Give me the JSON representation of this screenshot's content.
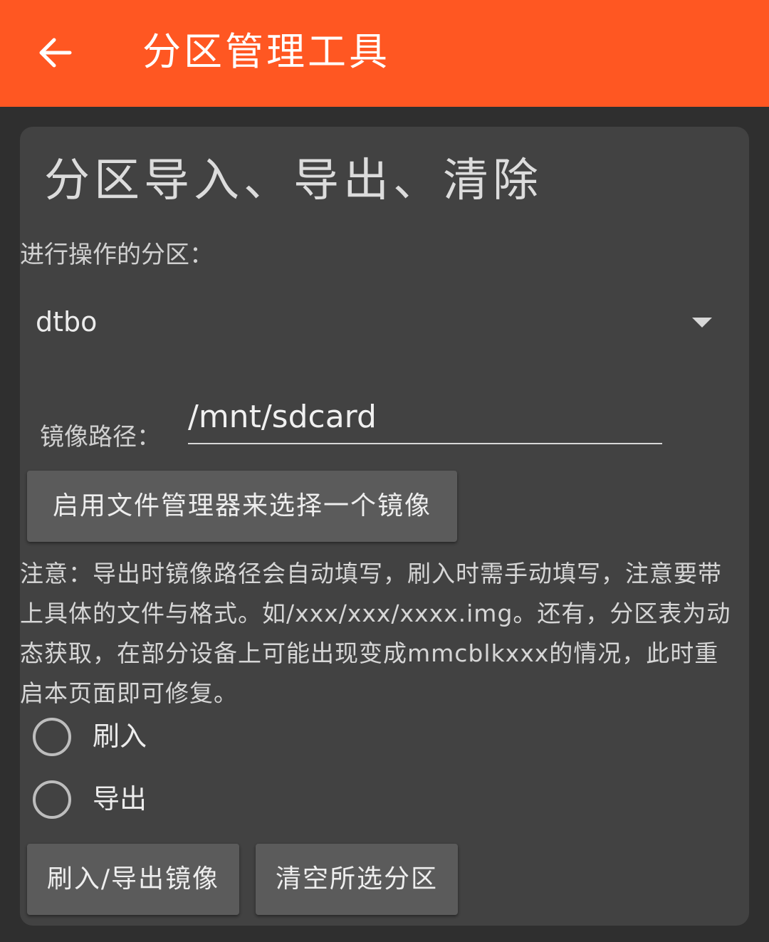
{
  "app_bar": {
    "title": "分区管理工具",
    "back_icon": "arrow-left-icon",
    "background": "#ff5722"
  },
  "card": {
    "title": "分区导入、导出、清除",
    "partition_label": "进行操作的分区：",
    "partition_selected": "dtbo",
    "image_path_label": "镜像路径：",
    "image_path_value": "/mnt/sdcard",
    "file_manager_button": "启用文件管理器来选择一个镜像",
    "note": "注意：导出时镜像路径会自动填写，刷入时需手动填写，注意要带上具体的文件与格式。如/xxx/xxx/xxxx.img。还有，分区表为动态获取，在部分设备上可能出现变成mmcblkxxx的情况，此时重启本页面即可修复。",
    "radio_options": [
      {
        "label": "刷入",
        "checked": false
      },
      {
        "label": "导出",
        "checked": false
      }
    ],
    "flash_export_button": "刷入/导出镜像",
    "clear_button": "清空所选分区"
  }
}
